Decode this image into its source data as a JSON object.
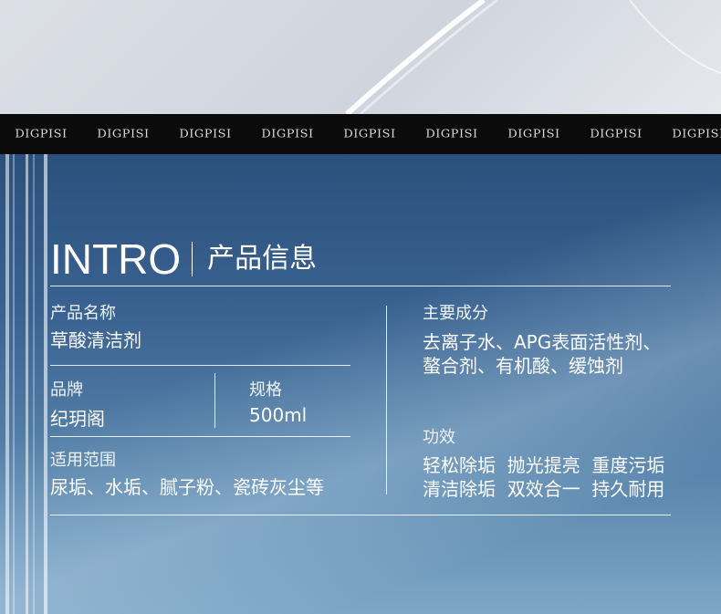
{
  "logo_strip": {
    "items": [
      "DIGPISI",
      "DIGPISI",
      "DIGPISI",
      "DIGPISI",
      "DIGPISI",
      "DIGPISI",
      "DIGPISI",
      "DIGPISI",
      "DIGPISI"
    ]
  },
  "heading": {
    "en": "INTRO",
    "cn": "产品信息"
  },
  "fields": {
    "product_name": {
      "label": "产品名称",
      "value": "草酸清洁剂"
    },
    "brand": {
      "label": "品牌",
      "value": "纪玥阁"
    },
    "spec": {
      "label": "规格",
      "value": "500ml"
    },
    "scope": {
      "label": "适用范围",
      "value": "尿垢、水垢、腻子粉、瓷砖灰尘等"
    },
    "ingredients": {
      "label": "主要成分",
      "lines": [
        "去离子水、APG表面活性剂、",
        "螯合剂、有机酸、缓蚀剂"
      ]
    },
    "effect": {
      "label": "功效",
      "lines": [
        "轻松除垢  抛光提亮  重度污垢",
        "清洁除垢  双效合一  持久耐用"
      ]
    }
  }
}
